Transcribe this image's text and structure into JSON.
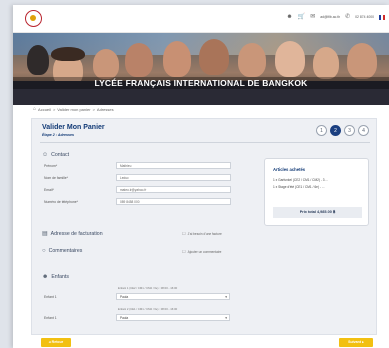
{
  "topbar": {
    "logo_icon": "school-logo",
    "login_icon": "user-icon",
    "cart_icon": "cart-icon",
    "email": "ad@lfib.ac.th",
    "phone": "02 874 4000",
    "language_flag": "french-flag"
  },
  "hero": {
    "banner_text": "LYCÉE FRANÇAIS INTERNATIONAL DE BANGKOK"
  },
  "breadcrumb": {
    "home": "Accueil",
    "sep1": ">",
    "item1": "Valider mon panier",
    "sep2": ">",
    "item2": "Adresses"
  },
  "main": {
    "title": "Valider Mon Panier",
    "subtitle": "Étape 2 : Adresses",
    "steps": [
      "1",
      "2",
      "3",
      "4"
    ],
    "active_step": 2,
    "contact": {
      "heading": "Contact",
      "fields": [
        {
          "label": "Prénom*",
          "value": "Mathieu"
        },
        {
          "label": "Nom de famille*",
          "value": "Leduc"
        },
        {
          "label": "Email*",
          "value": "mateo.lr@yahoo.fr"
        },
        {
          "label": "Numéro de téléphone*",
          "value": "089 8458 000"
        }
      ]
    },
    "billing": {
      "heading": "Adresse de facturation",
      "link": "J'ai besoin d'une facture"
    },
    "comments": {
      "heading": "Commentaires",
      "link": "Ajouter un commentaire"
    },
    "children": {
      "heading": "Enfants",
      "rows": [
        {
          "hint": "Enfant 1 (CE2 / CM1 / CM2 / 6e) : 08:00 - 16:00",
          "label": "Enfant 1",
          "value": "Paula"
        },
        {
          "hint": "Enfant 2 (CE1 / CM1 / CM2 / 6e) : 08:00 - 16:00",
          "label": "Enfant 1",
          "value": "Paula"
        }
      ]
    },
    "cart": {
      "title": "Articles achetés",
      "items": [
        "1 x Garfunkel (CE2 / CM1 / CM2) - 3 ...",
        "1 x Stage d'été (CE1 / CM1 / 6e) - ..."
      ],
      "total": "Prix total 4,985.00 ฿"
    }
  },
  "buttons": {
    "back": "◂ Retour",
    "next": "Suivant ▸"
  }
}
